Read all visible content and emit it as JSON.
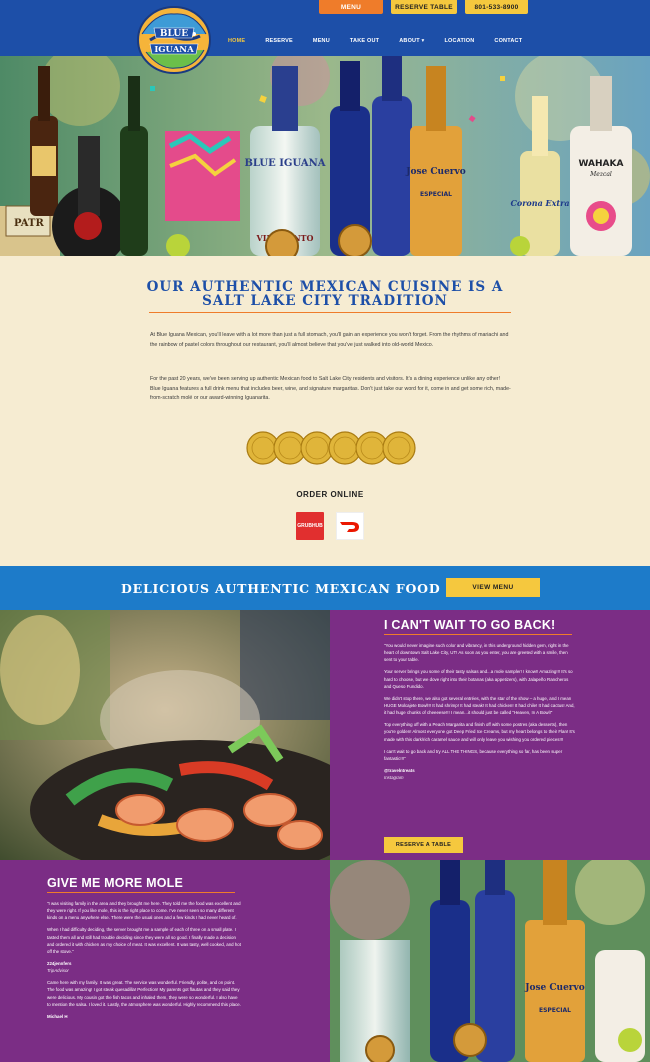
{
  "header": {
    "top_buttons": {
      "menu": "MENU",
      "reserve": "RESERVE TABLE",
      "phone": "801-533-8900"
    },
    "logo_text": [
      "BLUE",
      "IGUANA"
    ],
    "nav": [
      "HOME",
      "RESERVE",
      "MENU",
      "TAKE OUT",
      "ABOUT",
      "LOCATION",
      "CONTACT"
    ],
    "nav_active": "HOME"
  },
  "hero": {
    "bottle_labels": [
      "PATR",
      "BLUE IGUANA",
      "VINO TINTO",
      "Jose Cuervo",
      "ESPECIAL",
      "Corona Extra",
      "WAHAKA",
      "Mezcal"
    ]
  },
  "intro": {
    "title_line1": "OUR AUTHENTIC MEXICAN CUISINE IS A",
    "title_line2": "SALT LAKE CITY TRADITION",
    "paragraph1": "At Blue Iguana Mexican, you'll leave with a lot more than just a full stomach, you'll gain an experience you won't forget. From the rhythms of mariachi and the rainbow of pastel colors throughout our restaurant, you'll almost believe that you've just walked into old-world Mexico.",
    "paragraph2": "For the past 20 years, we've been serving up authentic Mexican food to Salt Lake City residents and visitors. It's a dining experience unlike any other! Blue Iguana features a full drink menu that includes beer, wine, and signature margaritas. Don't just take our word for it, come in and get some rich, made-from-scratch molé or our award-winning Iguanarita.",
    "order_title": "ORDER ONLINE",
    "grubhub_label": "GRUBHUB"
  },
  "banner": {
    "title": "DELICIOUS AUTHENTIC MEXICAN FOOD",
    "button": "VIEW MENU"
  },
  "review1": {
    "title": "I CAN'T WAIT TO GO BACK!",
    "paragraphs": [
      "\"You would never imagine such color and vibrancy, in this underground hidden gem, right in the heart of downtown Salt Lake City, UT! As soon as you enter, you are greeted with a smile, then sent to your table.",
      "Your server brings you some of their tasty salsas and...a mole sampler! I know!! Amazing!!! It's so hard to choose, but we dove right into their botanas (aka appetizers), with Jalapeño Rancheros and Queso Fundido.",
      "We didn't stop there, we also got several entrées, with the star of the show – a huge, and I mean HUGE Molcajete Bowl!!! It had shrimp! It had steak! It had chicken! It had chile! It had cactus! And, it had huge chunks of cheeeese!!! I mean...it should just be called \"Heaven, In A Bowl!\"",
      "Top everything off with a Peach Margarita and finish off with some postres (aka desserts), then you're golden! Almost everyone got Deep Fried Ice Creams, but my heart belongs to their Flan! It's made with this dark/rich caramel sauce and will only leave you wishing you ordered pieces!!!",
      "I can't wait to go back and try ALL THE THINGS, because everything so far, has been super fantastic!!!\""
    ],
    "reviewer": "@travelntreats",
    "source": "Instagram",
    "button": "RESERVE A TABLE"
  },
  "review2": {
    "title": "GIVE ME MORE MOLE",
    "paragraphs": [
      "\"I was visiting family in the area and they brought me here. They told me the food was excellent and they were right. If you like mole, this is the right place to come. I've never seen so many different kinds on a menu anywhere else. There were the usual ones and a few kinds I had never heard of.",
      "When I had difficulty deciding, the server brought me a sample of each of three on a small plate. I tasted them all and still had trouble deciding since they were all so good. I finally made a decision and ordered it with chicken as my choice of meat. It was excellent. It was tasty, well cooked, and hot off the stove.\""
    ],
    "reviewer": "224jennfers",
    "source": "TripAdvisor",
    "paragraph3": "Came here with my family. It was great. The service was wonderful. Friendly, polite, and on point. The food was amazing! I got steak quesadilla! Perfection! My parents got flautas and they said they were delicious. My cousin got the fish tacos and inhaled them, they were so wonderful. I also have to mention the salsa. I loved it. Lastly, the atmosphere was wonderful. Highly recommend this place.",
    "reviewer2": "Michael H"
  },
  "colors": {
    "blue": "#1d4fa8",
    "orange": "#ef7c2a",
    "yellow": "#f5c83e",
    "purple": "#7b2d85",
    "cream": "#f6ecd2",
    "banner_blue": "#1d7bc9"
  }
}
